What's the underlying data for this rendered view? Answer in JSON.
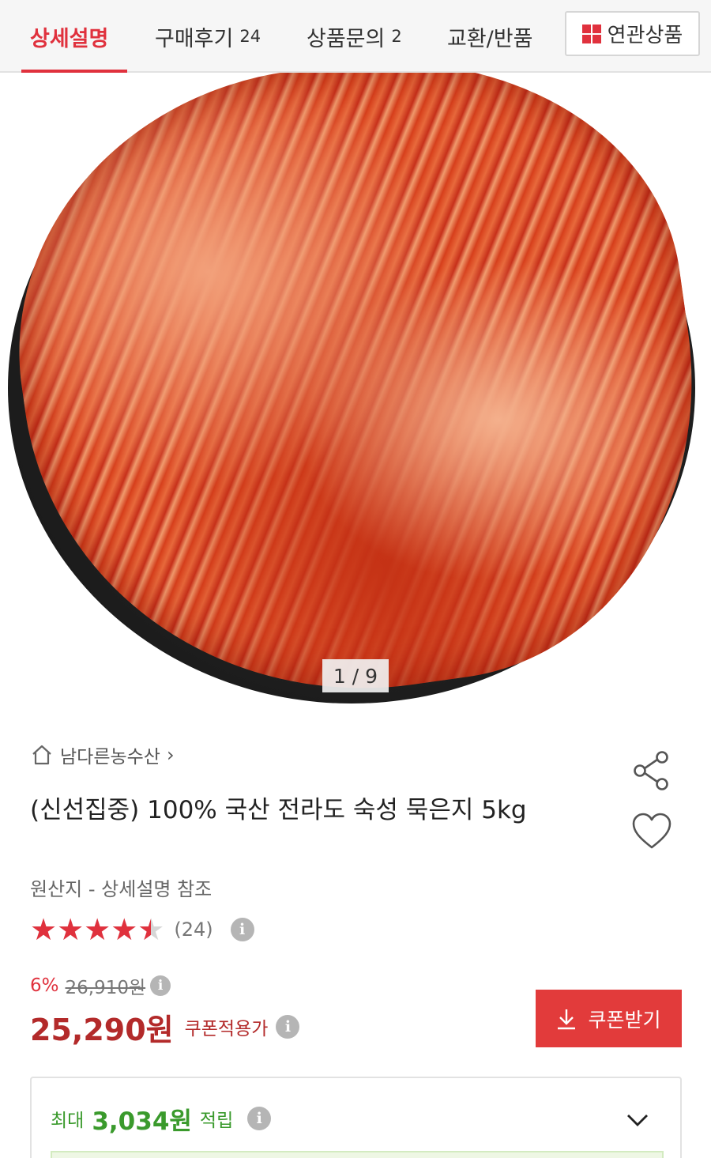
{
  "tabs": [
    {
      "label": "상세설명",
      "count": "",
      "active": true
    },
    {
      "label": "구매후기",
      "count": "24",
      "active": false
    },
    {
      "label": "상품문의",
      "count": "2",
      "active": false
    },
    {
      "label": "교환/반품",
      "count": "",
      "active": false
    }
  ],
  "related_button": {
    "label": "연관상품",
    "icon": "grid-icon"
  },
  "gallery": {
    "counter": "1 / 9",
    "image_description_icon": "product-photo"
  },
  "seller": {
    "name": "남다른농수산",
    "icon": "home-icon"
  },
  "product": {
    "title": "(신선집중) 100% 국산 전라도 숙성 묵은지 5kg",
    "origin": "원산지 - 상세설명 참조",
    "rating": 4.5,
    "rating_max": 5,
    "review_count": "(24)"
  },
  "pricing": {
    "discount_pct": "6%",
    "original_price": "26,910원",
    "price": "25,290원",
    "coupon_price_label": "쿠폰적용가",
    "coupon_button": "쿠폰받기"
  },
  "points": {
    "prefix": "최대",
    "amount": "3,034원",
    "suffix": "적립"
  },
  "colors": {
    "accent": "#e0313d",
    "price": "#b32a2a",
    "points": "#3a9a2c",
    "coupon_button": "#e23b3b"
  }
}
